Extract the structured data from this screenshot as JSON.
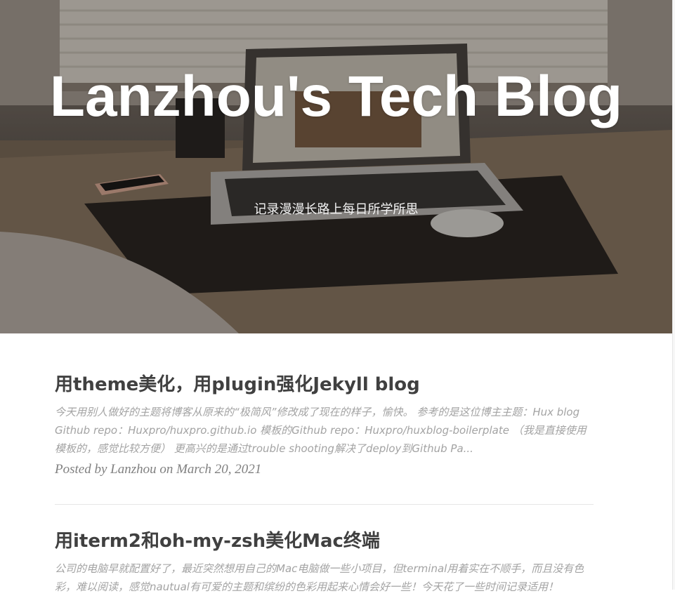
{
  "header": {
    "title": "Lanzhou's Tech Blog",
    "subtitle": "记录漫漫长路上每日所学所思"
  },
  "posts": [
    {
      "title": "用theme美化，用plugin强化Jekyll blog",
      "excerpt": "今天用别人做好的主题将博客从原来的“极简风”修改成了现在的样子，愉快。 参考的是这位博主主题：Hux blog Github repo：Huxpro/huxpro.github.io 模板的Github repo：Huxpro/huxblog-boilerplate （我是直接使用模板的，感觉比较方便） 更高兴的是通过trouble shooting解决了deploy到Github Pa...",
      "meta": "Posted by Lanzhou on March 20, 2021"
    },
    {
      "title": "用iterm2和oh-my-zsh美化Mac终端",
      "excerpt": "公司的电脑早就配置好了，最近突然想用自己的Mac电脑做一些小项目，但terminal用着实在不顺手，而且没有色彩，难以阅读，感觉nautual有可爱的主题和缤纷的色彩用起来心情会好一些！今天花了一些时间记录适用！",
      "meta": ""
    }
  ]
}
